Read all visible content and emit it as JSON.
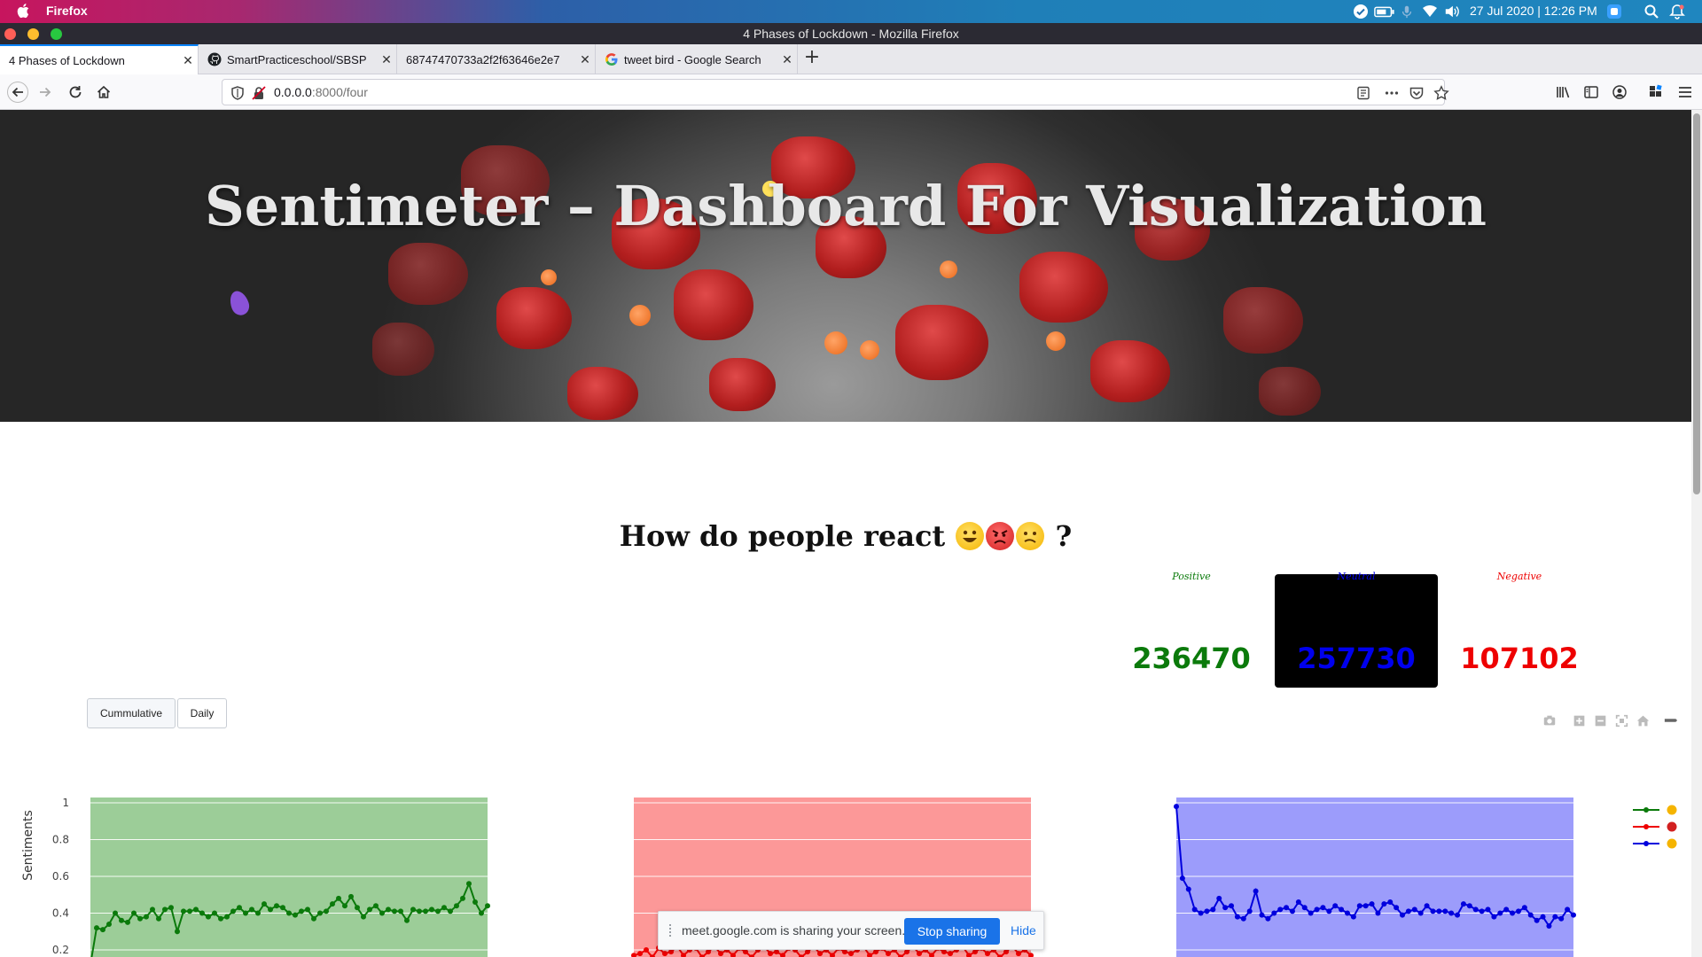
{
  "os": {
    "app_name": "Firefox",
    "clock": "27 Jul 2020 | 12:26 PM"
  },
  "window": {
    "title": "4 Phases of Lockdown - Mozilla Firefox"
  },
  "tabs": [
    {
      "label": "4 Phases of Lockdown",
      "icon": "none"
    },
    {
      "label": "SmartPracticeschool/SBSP",
      "icon": "github-icon"
    },
    {
      "label": "68747470733a2f2f63646e2e7",
      "icon": "none"
    },
    {
      "label": "tweet bird - Google Search",
      "icon": "google-icon"
    }
  ],
  "nav": {
    "url_host": "0.0.0.0",
    "url_rest": ":8000/four"
  },
  "hero": {
    "title": "Sentimeter – Dashboard For Visualization"
  },
  "reaction": {
    "title_prefix": "How do people react",
    "title_suffix": "?"
  },
  "stats": {
    "positive": {
      "label": "Positive",
      "value": "236470",
      "color": "#0b7a0b"
    },
    "neutral": {
      "label": "Neutral",
      "value": "257730",
      "color": "#0000ee"
    },
    "negative": {
      "label": "Negative",
      "value": "107102",
      "color": "#ee0000"
    }
  },
  "controls": {
    "cumulative_label": "Cummulative",
    "daily_label": "Daily"
  },
  "share_bar": {
    "message": "meet.google.com is sharing your screen.",
    "stop_label": "Stop sharing",
    "hide_label": "Hide"
  },
  "chart_data": {
    "type": "line",
    "ylabel": "Sentiments",
    "y_ticks": [
      "1",
      "0.8",
      "0.6",
      "0.4",
      "0.2"
    ],
    "ylim": [
      0.15,
      1.02
    ],
    "grid": true,
    "legend_placement": "top-right",
    "series": [
      {
        "color": "#0b7a0b",
        "background": "#9ccd98",
        "values": [
          0.12,
          0.32,
          0.31,
          0.34,
          0.4,
          0.36,
          0.35,
          0.4,
          0.37,
          0.38,
          0.42,
          0.37,
          0.42,
          0.43,
          0.3,
          0.41,
          0.41,
          0.42,
          0.4,
          0.38,
          0.4,
          0.37,
          0.38,
          0.41,
          0.43,
          0.4,
          0.42,
          0.4,
          0.45,
          0.42,
          0.44,
          0.43,
          0.4,
          0.39,
          0.41,
          0.42,
          0.37,
          0.4,
          0.41,
          0.45,
          0.48,
          0.44,
          0.49,
          0.43,
          0.38,
          0.42,
          0.44,
          0.4,
          0.42,
          0.41,
          0.41,
          0.36,
          0.42,
          0.41,
          0.41,
          0.42,
          0.41,
          0.43,
          0.41,
          0.44,
          0.48,
          0.56,
          0.46,
          0.4,
          0.44
        ]
      },
      {
        "color": "#ee0000",
        "background": "#fc9898",
        "values": [
          0.17,
          0.18,
          0.2,
          0.16,
          0.21,
          0.18,
          0.19,
          0.22,
          0.17,
          0.2,
          0.21,
          0.16,
          0.19,
          0.22,
          0.18,
          0.2,
          0.17,
          0.21,
          0.19,
          0.16,
          0.2,
          0.22,
          0.18,
          0.19,
          0.17,
          0.21,
          0.2,
          0.16,
          0.19,
          0.22,
          0.18,
          0.2,
          0.17,
          0.21,
          0.19,
          0.18,
          0.2,
          0.22,
          0.17,
          0.19,
          0.21,
          0.18,
          0.2,
          0.16,
          0.19,
          0.22,
          0.18,
          0.2,
          0.17,
          0.21,
          0.19,
          0.18,
          0.2,
          0.22,
          0.17,
          0.19,
          0.21,
          0.18,
          0.2,
          0.16,
          0.19,
          0.22,
          0.18,
          0.2,
          0.17
        ]
      },
      {
        "color": "#0000dd",
        "background": "#9c9cfb",
        "values": [
          0.98,
          0.59,
          0.53,
          0.42,
          0.4,
          0.41,
          0.42,
          0.48,
          0.43,
          0.44,
          0.38,
          0.37,
          0.41,
          0.52,
          0.39,
          0.37,
          0.4,
          0.42,
          0.43,
          0.41,
          0.46,
          0.43,
          0.4,
          0.42,
          0.43,
          0.41,
          0.44,
          0.42,
          0.4,
          0.38,
          0.44,
          0.44,
          0.45,
          0.4,
          0.45,
          0.46,
          0.43,
          0.39,
          0.41,
          0.42,
          0.4,
          0.44,
          0.41,
          0.41,
          0.41,
          0.4,
          0.39,
          0.45,
          0.44,
          0.42,
          0.41,
          0.42,
          0.38,
          0.4,
          0.42,
          0.4,
          0.41,
          0.43,
          0.39,
          0.36,
          0.38,
          0.33,
          0.38,
          0.37,
          0.42,
          0.39
        ]
      }
    ]
  }
}
